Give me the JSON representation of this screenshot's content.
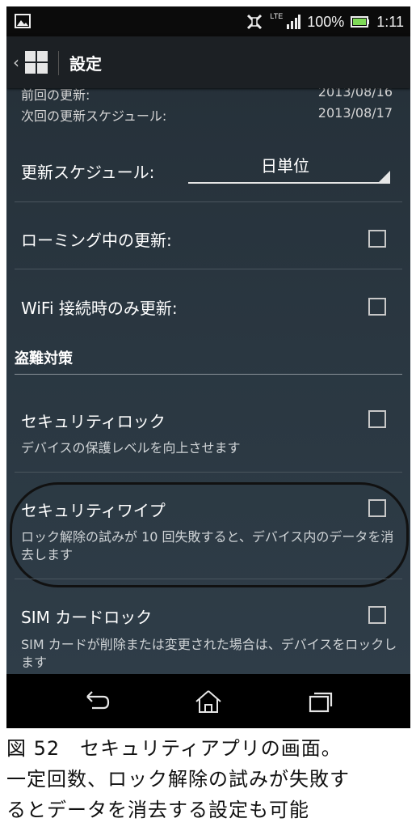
{
  "status_bar": {
    "battery": "100%",
    "time": "1:11",
    "network": "LTE"
  },
  "app_bar": {
    "title": "設定"
  },
  "info": {
    "last_update_label": "前回の更新:",
    "last_update_value": "2013/08/16",
    "next_update_label": "次回の更新スケジュール:",
    "next_update_value": "2013/08/17"
  },
  "schedule": {
    "label": "更新スケジュール:",
    "value": "日単位"
  },
  "roaming": {
    "label": "ローミング中の更新:"
  },
  "wifi_only": {
    "label": "WiFi 接続時のみ更新:"
  },
  "section": {
    "anti_theft": "盗難対策"
  },
  "security_lock": {
    "title": "セキュリティロック",
    "subtitle": "デバイスの保護レベルを向上させます"
  },
  "security_wipe": {
    "title": "セキュリティワイプ",
    "subtitle": "ロック解除の試みが 10 回失敗すると、デバイス内のデータを消去します"
  },
  "sim_lock": {
    "title": "SIM カードロック",
    "subtitle": "SIM カードが削除または変更された場合は、デバイスをロックします"
  },
  "caption": {
    "line1": "図 52　セキュリティアプリの画面。",
    "line2": "一定回数、ロック解除の試みが失敗す",
    "line3": "るとデータを消去する設定も可能"
  }
}
